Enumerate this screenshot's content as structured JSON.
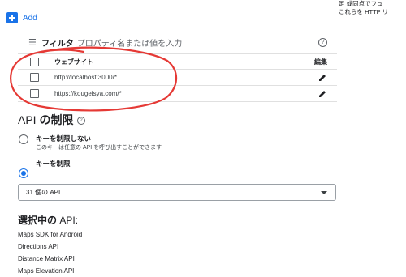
{
  "add": {
    "label": "Add"
  },
  "right_note": {
    "line1": "足 或同点でフュ",
    "line2": "これらを HTTP リ"
  },
  "filter": {
    "label": "フィルタ",
    "placeholder": "プロパティ名または値を入力"
  },
  "table": {
    "header_website": "ウェブサイト",
    "header_edit": "編集",
    "rows": [
      {
        "url": "http://localhost:3000/*"
      },
      {
        "url": "https://kougeisya.com/*"
      }
    ]
  },
  "api_restrictions": {
    "title_prefix": "API ",
    "title_bold": "の制限",
    "option_none_label": "キーを制限しない",
    "option_none_sub": "このキーは任意の API を呼び出すことができます",
    "option_restrict_label": "キーを制限",
    "selected_option": "restrict"
  },
  "api_select": {
    "value": "31 個の API"
  },
  "selected_apis": {
    "heading_bold": "選択中の",
    "heading_rest": " API:",
    "items": [
      "Maps SDK for Android",
      "Directions API",
      "Distance Matrix API",
      "Maps Elevation API"
    ]
  },
  "colors": {
    "accent": "#1a73e8",
    "annotation": "#e53935"
  }
}
